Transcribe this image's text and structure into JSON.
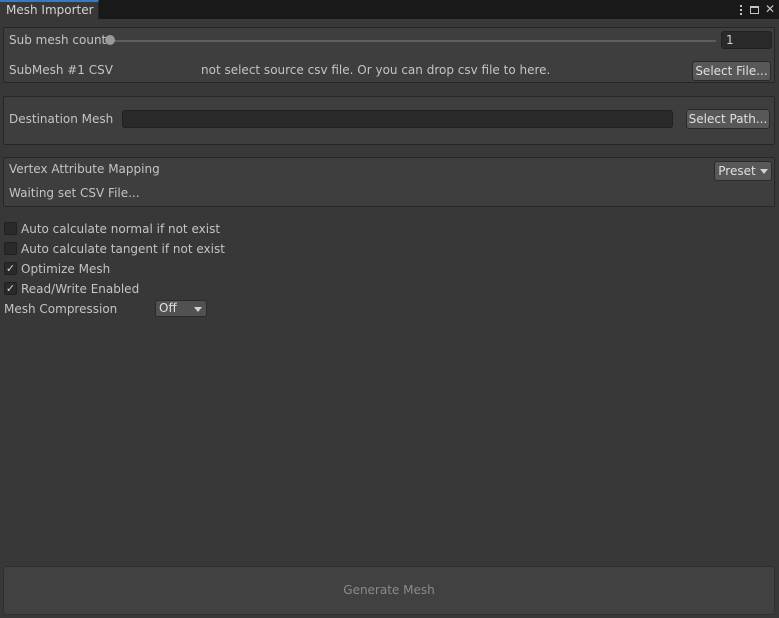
{
  "window": {
    "tab_title": "Mesh Importer",
    "icons": [
      "kebab-menu-icon",
      "maximize-icon",
      "close-icon"
    ]
  },
  "submesh": {
    "count_label": "Sub mesh count",
    "count_value": "1",
    "slider_level": 0,
    "csv_label": "SubMesh #1 CSV",
    "csv_message": "not select source csv file. Or you can drop csv file to here.",
    "select_file_label": "Select File..."
  },
  "destination": {
    "label": "Destination Mesh",
    "path_value": "",
    "select_path_label": "Select Path..."
  },
  "mapping": {
    "title": "Vertex Attribute Mapping",
    "status": "Waiting set CSV File...",
    "preset_label": "Preset"
  },
  "options": [
    {
      "label": "Auto calculate normal if not exist",
      "checked": false
    },
    {
      "label": "Auto calculate tangent if not exist",
      "checked": false
    },
    {
      "label": "Optimize Mesh",
      "checked": true
    },
    {
      "label": "Read/Write Enabled",
      "checked": true
    }
  ],
  "compression": {
    "label": "Mesh Compression",
    "selected": "Off"
  },
  "generate_label": "Generate Mesh",
  "colors": {
    "background": "#383838",
    "tab_accent": "#3a79bb",
    "field": "#2a2a2a"
  }
}
